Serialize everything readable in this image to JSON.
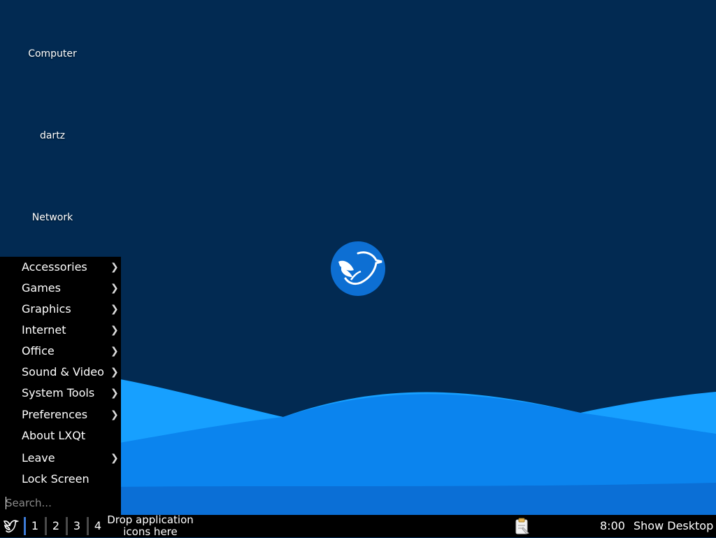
{
  "desktop": {
    "icons": [
      {
        "label": "Computer"
      },
      {
        "label": "dartz"
      },
      {
        "label": "Network"
      }
    ],
    "logo_icon": "lubuntu-bird-logo"
  },
  "colors": {
    "background": "#022a52",
    "wave_light": "#17a0ff",
    "wave_mid": "#0b84ee",
    "wave_dark": "#0b6fd6",
    "logo": "#0d6fd3",
    "panel": "#000000",
    "active_workspace": "#3d7bd6"
  },
  "menu": {
    "items": [
      {
        "label": "Accessories",
        "submenu": true
      },
      {
        "label": "Games",
        "submenu": true
      },
      {
        "label": "Graphics",
        "submenu": true
      },
      {
        "label": "Internet",
        "submenu": true
      },
      {
        "label": "Office",
        "submenu": true
      },
      {
        "label": "Sound & Video",
        "submenu": true
      },
      {
        "label": "System Tools",
        "submenu": true
      },
      {
        "label": "Preferences",
        "submenu": true
      },
      {
        "label": "About LXQt",
        "submenu": false
      },
      {
        "label": "Leave",
        "submenu": true
      },
      {
        "label": "Lock Screen",
        "submenu": false
      }
    ],
    "chevron": "❯",
    "search": {
      "placeholder": "Search...",
      "value": ""
    }
  },
  "taskbar": {
    "start_icon": "lxqt-bird-icon",
    "workspaces": [
      "1",
      "2",
      "3",
      "4"
    ],
    "active_workspace": "1",
    "drop_hint_line1": "Drop application",
    "drop_hint_line2": "icons here",
    "clipboard_icon": "clipboard-icon",
    "clock": "8:00",
    "show_desktop": "Show Desktop"
  }
}
